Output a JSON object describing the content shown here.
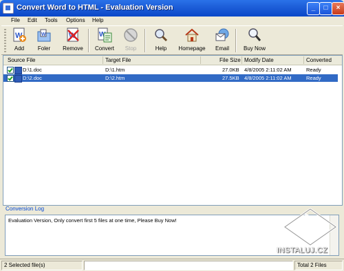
{
  "window": {
    "title": "Convert Word to HTML  -  Evaluation Version"
  },
  "menu": [
    "File",
    "Edit",
    "Tools",
    "Options",
    "Help"
  ],
  "toolbar": {
    "add": "Add",
    "folder": "Foler",
    "remove": "Remove",
    "convert": "Convert",
    "stop": "Stop",
    "help": "Help",
    "homepage": "Homepage",
    "email": "Email",
    "buynow": "Buy Now"
  },
  "table": {
    "headers": [
      "Source File",
      "Target File",
      "File Size",
      "Modify Date",
      "Converted"
    ],
    "rows": [
      {
        "source": "D:\\1.doc",
        "target": "D:\\1.htm",
        "size": "27.0KB",
        "date": "4/8/2005 2:11:02 AM",
        "status": "Ready",
        "checked": true,
        "selected": false
      },
      {
        "source": "D:\\2.doc",
        "target": "D:\\2.htm",
        "size": "27.5KB",
        "date": "4/8/2005 2:11:02 AM",
        "status": "Ready",
        "checked": true,
        "selected": true
      }
    ]
  },
  "log": {
    "title": "Conversion Log",
    "text": "Evaluation Version, Only convert first 5 files at one time, Please Buy Now!"
  },
  "status": {
    "selected": "2 Selected file(s)",
    "progress": "",
    "total": "Total 2 Files"
  },
  "watermark": "INSTALUJ.CZ",
  "colors": {
    "selection": "#316ac5",
    "titlebar": "#0a47c8"
  }
}
